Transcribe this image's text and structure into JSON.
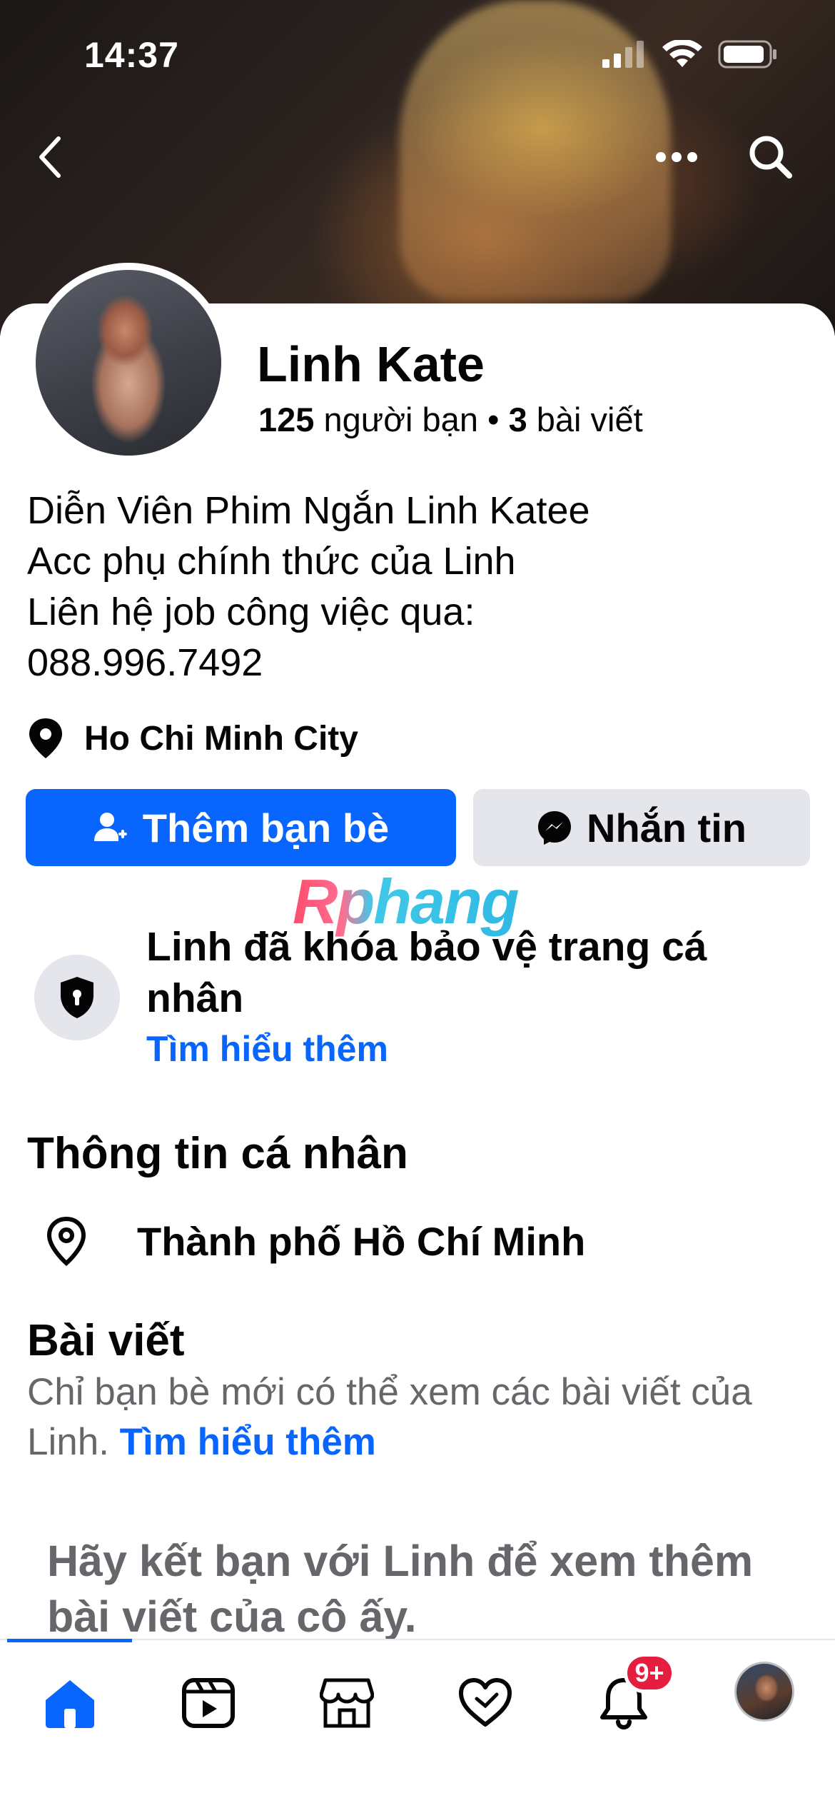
{
  "status_bar": {
    "time": "14:37"
  },
  "profile": {
    "name": "Linh Kate",
    "friends_count": "125",
    "friends_label": "người bạn",
    "separator": "•",
    "posts_count": "3",
    "posts_label": "bài viết",
    "bio_lines": [
      "Diễn Viên Phim Ngắn Linh Katee",
      "Acc phụ chính thức của Linh",
      "Liên hệ job công việc qua:",
      "088.996.7492"
    ],
    "location": "Ho Chi Minh City"
  },
  "actions": {
    "add_friend": "Thêm bạn bè",
    "message": "Nhắn tin"
  },
  "watermark": "Rphang",
  "lock_notice": {
    "text": "Linh đã khóa bảo vệ trang cá nhân",
    "link": "Tìm hiểu thêm"
  },
  "personal_info": {
    "title": "Thông tin cá nhân",
    "city": "Thành phố Hồ Chí Minh"
  },
  "posts": {
    "title": "Bài viết",
    "desc": "Chỉ bạn bè mới có thể xem các bài viết của Linh.",
    "link": "Tìm hiểu thêm",
    "friend_hint": "Hãy kết bạn với Linh để xem thêm bài viết của cô ấy."
  },
  "tabbar": {
    "active": "home",
    "notification_badge": "9+",
    "active_color": "#0866ff"
  }
}
